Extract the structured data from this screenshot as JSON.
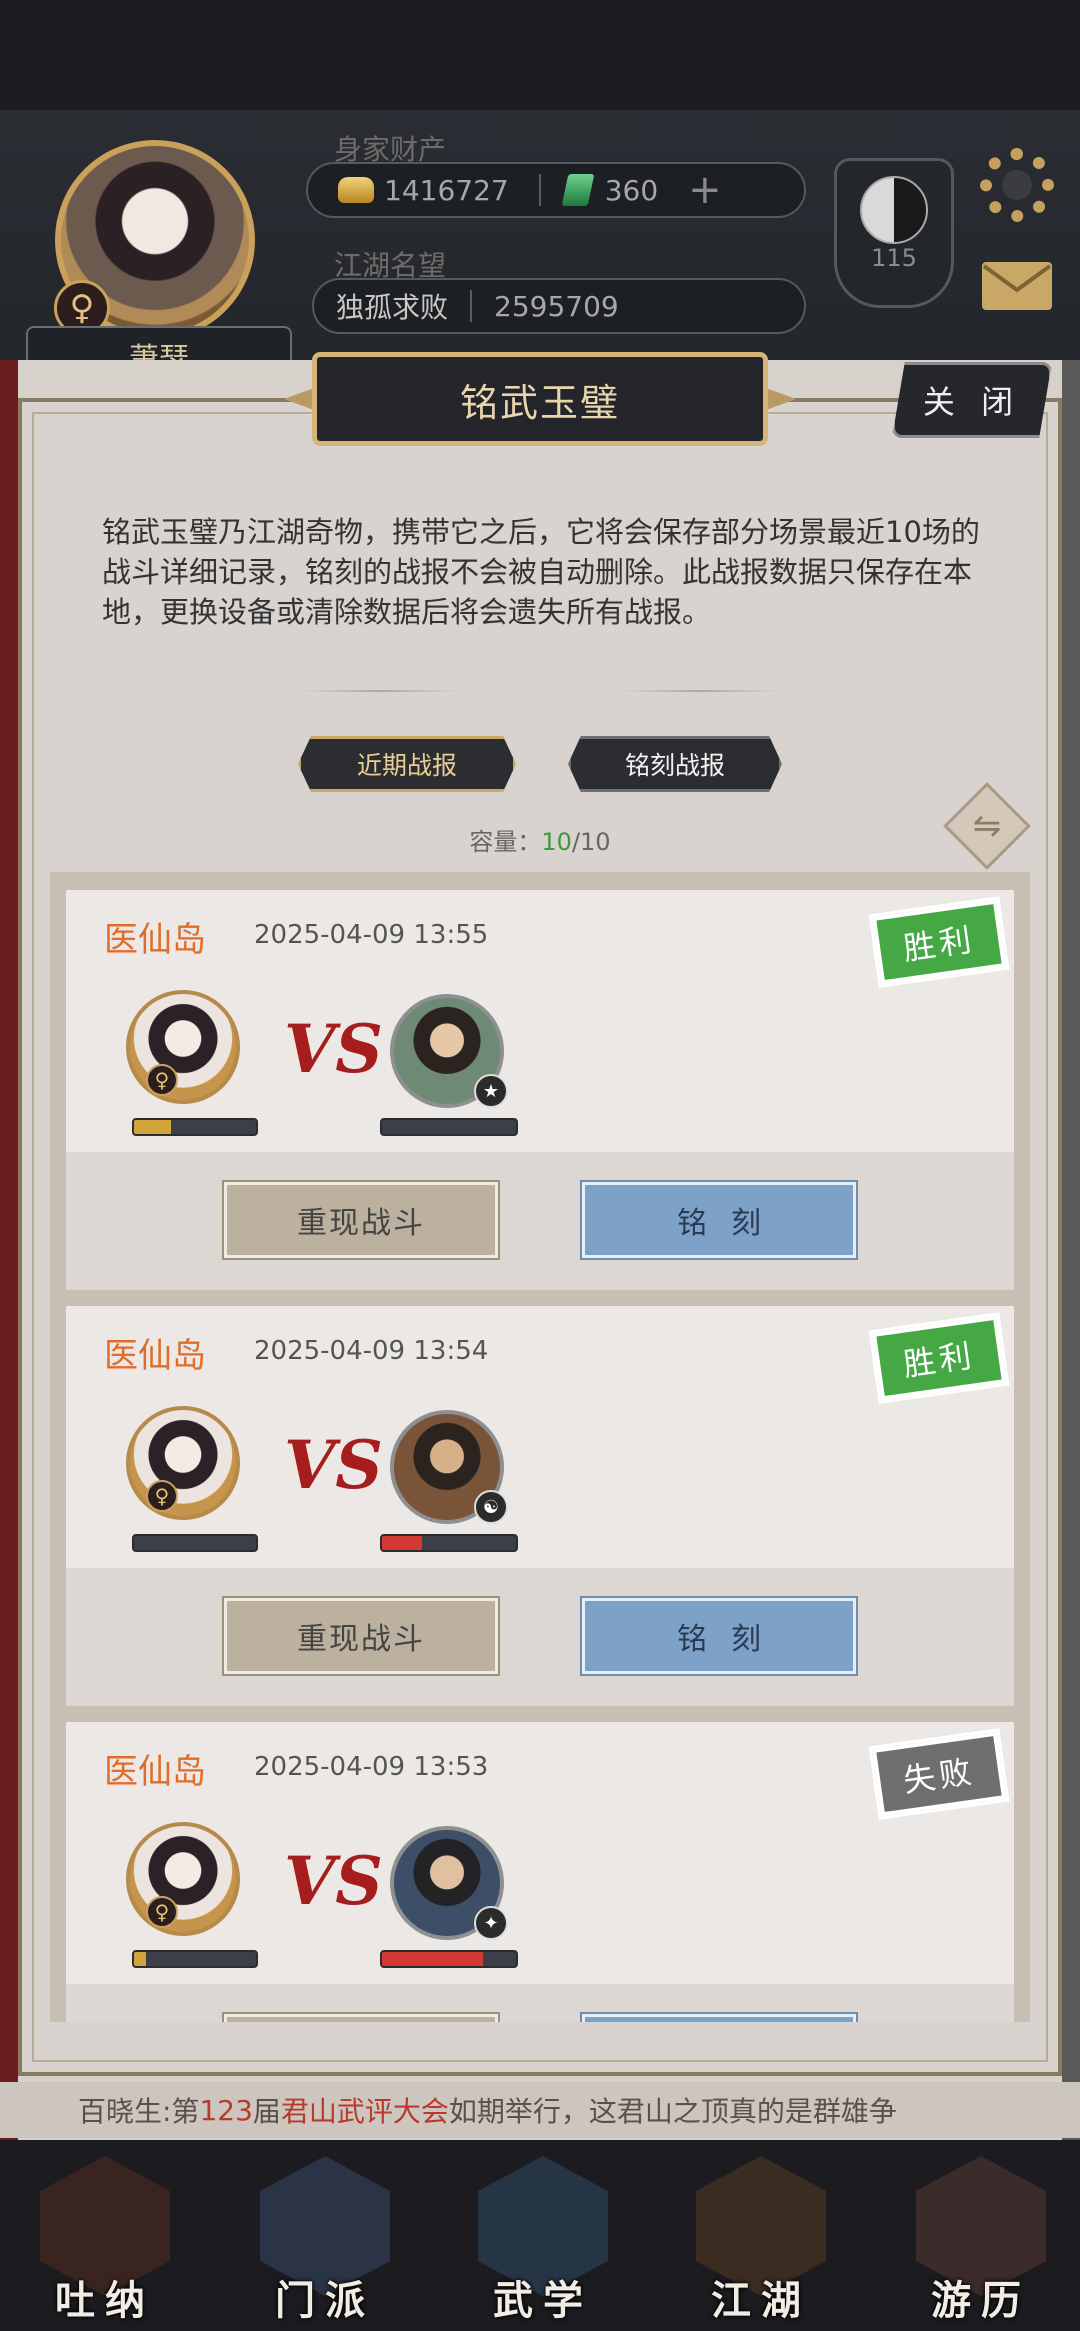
{
  "player": {
    "name": "萧瑟",
    "gender_symbol": "♀",
    "wealth_label": "身家财产",
    "silver": "1416727",
    "jade": "360",
    "add_symbol": "+",
    "fame_label": "江湖名望",
    "fame_title": "独孤求败",
    "fame_value": "2595709",
    "level": "115"
  },
  "dialog": {
    "title": "铭武玉璧",
    "close_label": "关 闭",
    "description": "铭武玉璧乃江湖奇物，携带它之后，它将会保存部分场景最近10场的战斗详细记录，铭刻的战报不会被自动删除。此战报数据只保存在本地，更换设备或清除数据后将会遗失所有战报。",
    "tabs": {
      "recent": "近期战报",
      "engraved": "铭刻战报"
    },
    "capacity_label": "容量：",
    "capacity_used": "10",
    "capacity_total": "/10",
    "vs_text": "VS",
    "replay_label": "重现战斗",
    "engrave_label": "铭刻"
  },
  "records": [
    {
      "location": "医仙岛",
      "time": "2025-04-09 13:55",
      "result": "胜利",
      "result_type": "win",
      "player_hp": 0.3,
      "opponent_hp": 0.0,
      "opponent_badge": "★"
    },
    {
      "location": "医仙岛",
      "time": "2025-04-09 13:54",
      "result": "胜利",
      "result_type": "win",
      "player_hp": 0.0,
      "opponent_hp": 0.3,
      "opponent_badge": "☯"
    },
    {
      "location": "医仙岛",
      "time": "2025-04-09 13:53",
      "result": "失败",
      "result_type": "lose",
      "player_hp": 0.1,
      "opponent_hp": 0.75,
      "opponent_badge": "✦"
    }
  ],
  "ticker": {
    "prefix": "百晓生:第",
    "number": "123",
    "mid": "届",
    "event": "君山武评大会",
    "suffix": "如期举行，这君山之顶真的是群雄争"
  },
  "nav": [
    {
      "label": "吐纳"
    },
    {
      "label": "门派"
    },
    {
      "label": "武学"
    },
    {
      "label": "江湖"
    },
    {
      "label": "游历"
    }
  ],
  "colors": {
    "win": "#46a845",
    "lose": "#6f6f6f",
    "place": "#e06d2c",
    "accent_gold": "#d5b57a"
  }
}
